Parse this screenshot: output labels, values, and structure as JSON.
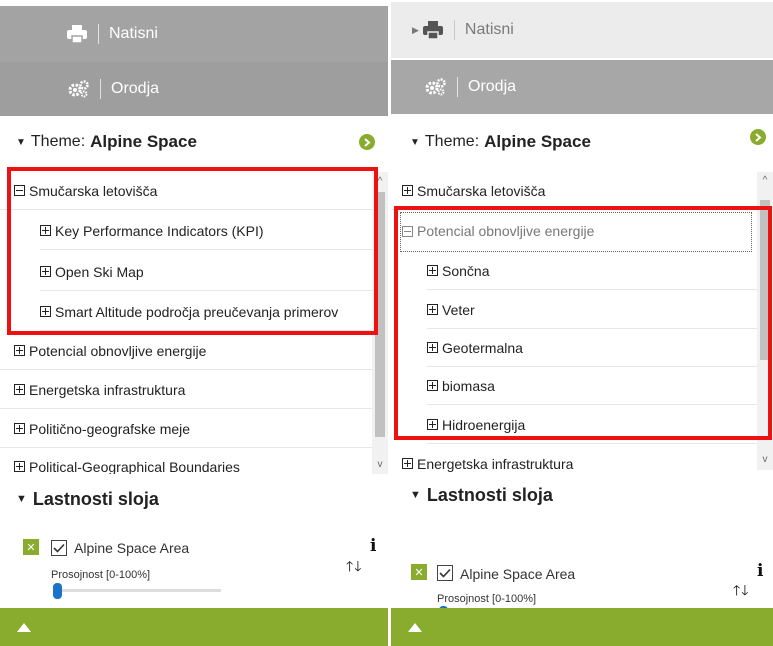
{
  "left_panel": {
    "print_label": "Natisni",
    "tools_label": "Orodja",
    "theme_prefix": "Theme:",
    "theme_name": "Alpine Space",
    "tree": [
      {
        "label": "Smučarska letovišča",
        "expanded": true,
        "level": 0
      },
      {
        "label": "Key Performance Indicators (KPI)",
        "expanded": false,
        "level": 1
      },
      {
        "label": "Open Ski Map",
        "expanded": false,
        "level": 1
      },
      {
        "label": "Smart Altitude področja preučevanja primerov",
        "expanded": false,
        "level": 1
      },
      {
        "label": "Potencial obnovljive energije",
        "expanded": false,
        "level": 0
      },
      {
        "label": "Energetska infrastruktura",
        "expanded": false,
        "level": 0
      },
      {
        "label": "Politično-geografske meje",
        "expanded": false,
        "level": 0
      },
      {
        "label": "Political-Geographical Boundaries",
        "expanded": false,
        "level": 0
      }
    ],
    "layer_props_title": "Lastnosti sloja",
    "layer_name": "Alpine Space Area",
    "opacity_label": "Prosojnost [0-100%]",
    "opacity_value_percent": 0
  },
  "right_panel": {
    "print_label": "Natisni",
    "tools_label": "Orodja",
    "theme_prefix": "Theme:",
    "theme_name": "Alpine Space",
    "tree": [
      {
        "label": "Smučarska letovišča",
        "expanded": false,
        "level": 0
      },
      {
        "label": "Potencial obnovljive energije",
        "expanded": true,
        "level": 0
      },
      {
        "label": "Sončna",
        "expanded": false,
        "level": 1
      },
      {
        "label": "Veter",
        "expanded": false,
        "level": 1
      },
      {
        "label": "Geotermalna",
        "expanded": false,
        "level": 1
      },
      {
        "label": "biomasa",
        "expanded": false,
        "level": 1
      },
      {
        "label": "Hidroenergija",
        "expanded": false,
        "level": 1
      },
      {
        "label": "Energetska infrastruktura",
        "expanded": false,
        "level": 0
      }
    ],
    "layer_props_title": "Lastnosti sloja",
    "layer_name": "Alpine Space Area",
    "opacity_label": "Prosojnost [0-100%]",
    "opacity_value_percent": 0
  },
  "colors": {
    "accent_green": "#8aac2e",
    "highlight_red": "#ee1111",
    "slider_blue": "#1a73c8"
  },
  "icons": {
    "print": "printer-icon",
    "tools": "gears-icon",
    "go": "arrow-right-circle-icon",
    "info": "info-icon",
    "sort": "up-down-arrows-icon",
    "collapse_footer": "triangle-up-icon"
  }
}
